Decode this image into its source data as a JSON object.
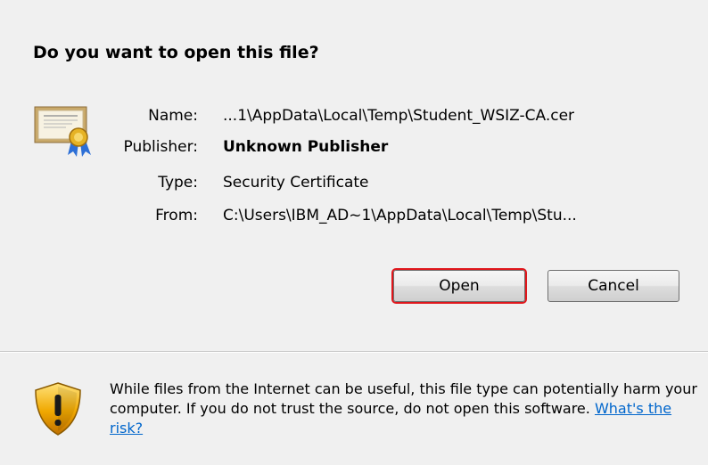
{
  "dialog": {
    "question": "Do you want to open this file?"
  },
  "file": {
    "name_label": "Name:",
    "name_value": "...1\\AppData\\Local\\Temp\\Student_WSIZ-CA.cer",
    "publisher_label": "Publisher:",
    "publisher_value": "Unknown Publisher",
    "type_label": "Type:",
    "type_value": "Security Certificate",
    "from_label": "From:",
    "from_value": "C:\\Users\\IBM_AD~1\\AppData\\Local\\Temp\\Stu..."
  },
  "buttons": {
    "open_label": "Open",
    "cancel_label": "Cancel"
  },
  "warning": {
    "text": "While files from the Internet can be useful, this file type can potentially harm your computer. If you do not trust the source, do not open this software.",
    "link_label": "What's the risk?"
  },
  "colors": {
    "highlight": "#e0161b",
    "link": "#0066cc",
    "background": "#f0f0f0"
  },
  "icons": {
    "file": "certificate-icon",
    "warning": "warning-shield-icon"
  }
}
